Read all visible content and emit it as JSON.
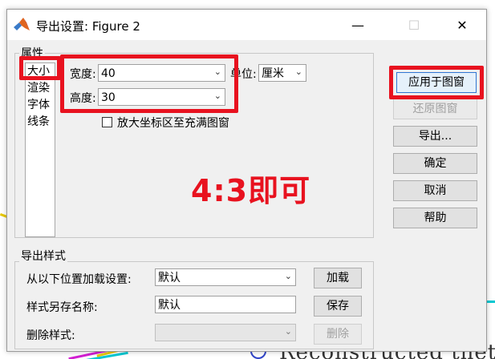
{
  "window": {
    "title": "导出设置: Figure 2",
    "minimize": "—",
    "maximize": "☐",
    "close": "✕"
  },
  "properties": {
    "group_label": "属性",
    "items": [
      "大小",
      "渲染",
      "字体",
      "线条"
    ],
    "selected_item": "大小",
    "width_label": "宽度:",
    "width_value": "40",
    "height_label": "高度:",
    "height_value": "30",
    "unit_label": "单位:",
    "unit_value": "厘米",
    "expand_axes_label": "放大坐标区至充满图窗",
    "expand_axes_checked": false
  },
  "buttons": {
    "apply": "应用于图窗",
    "restore": "还原图窗",
    "export": "导出...",
    "ok": "确定",
    "cancel": "取消",
    "help": "帮助"
  },
  "export_styles": {
    "group_label": "导出样式",
    "load_label": "从以下位置加载设置:",
    "load_value": "默认",
    "load_button": "加载",
    "save_label": "样式另存名称:",
    "save_value": "默认",
    "save_button": "保存",
    "delete_label": "删除样式:",
    "delete_value": "",
    "delete_button": "删除"
  },
  "annotation": {
    "text": "4:3即可",
    "color": "#e8121f"
  },
  "background": {
    "text": "Reconstructed theta"
  },
  "icons": {
    "app": "matlab-logo-icon",
    "dropdown": "chevron-down-icon"
  }
}
